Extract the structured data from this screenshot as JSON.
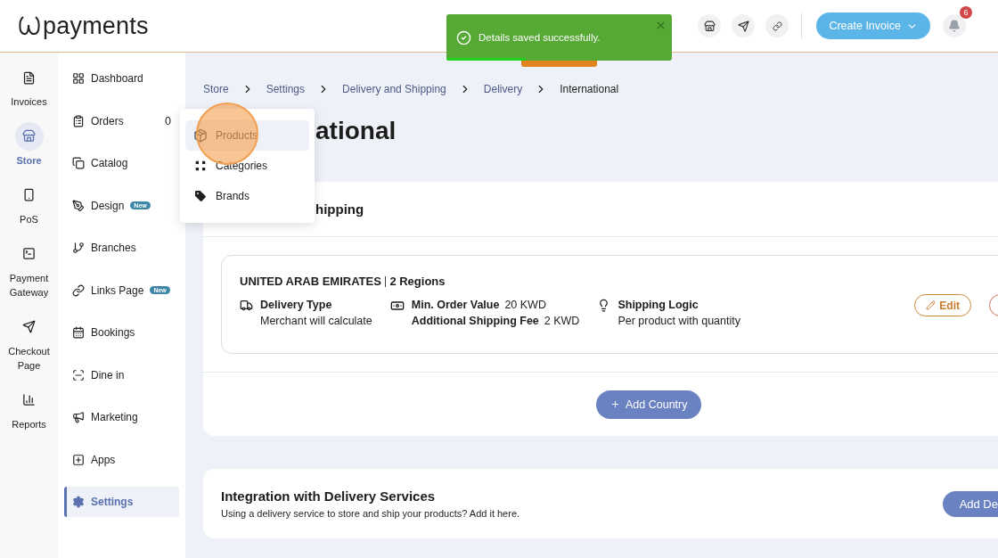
{
  "header": {
    "logo_text": "payments",
    "create_button": "Create Invoice",
    "notification_count": "6"
  },
  "toast": {
    "message": "Details saved successfully.",
    "level": 0.35
  },
  "rail": [
    {
      "label": "Invoices",
      "selected": false
    },
    {
      "label": "Store",
      "selected": true
    },
    {
      "label": "PoS",
      "selected": false
    },
    {
      "label": "Payment Gateway",
      "selected": false
    },
    {
      "label": "Checkout Page",
      "selected": false
    },
    {
      "label": "Reports",
      "selected": false
    }
  ],
  "sidebar": [
    {
      "label": "Dashboard",
      "selected": false
    },
    {
      "label": "Orders",
      "count": "0",
      "selected": false
    },
    {
      "label": "Catalog",
      "selected": false
    },
    {
      "label": "Design",
      "badge": "New",
      "selected": false
    },
    {
      "label": "Branches",
      "selected": false
    },
    {
      "label": "Links Page",
      "badge": "New",
      "selected": false
    },
    {
      "label": "Bookings",
      "selected": false
    },
    {
      "label": "Dine in",
      "selected": false
    },
    {
      "label": "Marketing",
      "selected": false
    },
    {
      "label": "Apps",
      "selected": false
    },
    {
      "label": "Settings",
      "selected": true
    }
  ],
  "catalog_menu": [
    {
      "label": "Products",
      "selected": true
    },
    {
      "label": "Categories",
      "selected": false
    },
    {
      "label": "Brands",
      "selected": false
    }
  ],
  "breadcrumb": [
    "Store",
    "Settings",
    "Delivery and Shipping",
    "Delivery",
    "International"
  ],
  "page_title": "ational",
  "shipping_card": {
    "title": "hipping",
    "country": {
      "name": "UNITED ARAB EMIRATES",
      "regions": "2 Regions",
      "delivery_type": {
        "label": "Delivery Type",
        "value": "Merchant will calculate"
      },
      "min_order": {
        "label": "Min. Order Value",
        "value": "20 KWD"
      },
      "shipping_fee": {
        "label": "Additional Shipping Fee",
        "value": "2 KWD"
      },
      "shipping_logic": {
        "label": "Shipping Logic",
        "value": "Per product with quantity"
      },
      "edit_button": "Edit"
    },
    "add_button": "Add Country"
  },
  "integration_card": {
    "title": "Integration with Delivery Services",
    "description": "Using a delivery service to store and ship your products? Add it here.",
    "button": "Add De"
  }
}
